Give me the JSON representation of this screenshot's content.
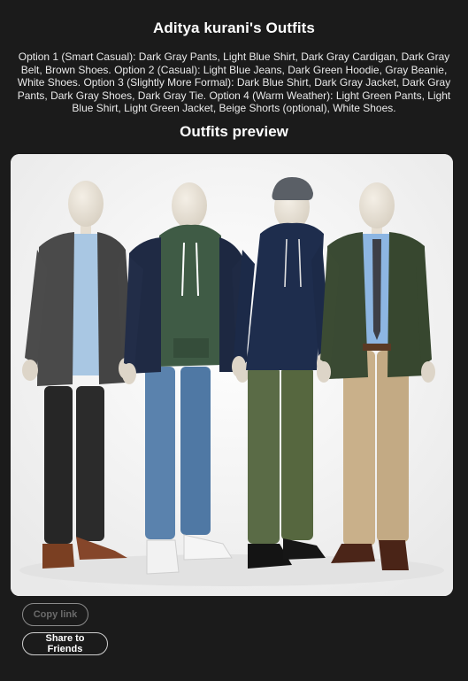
{
  "header": {
    "title": "Aditya kurani's Outfits"
  },
  "description": "Option 1 (Smart Casual): Dark Gray Pants, Light Blue Shirt, Dark Gray Cardigan, Dark Gray Belt, Brown Shoes. Option 2 (Casual): Light Blue Jeans, Dark Green Hoodie, Gray Beanie, White Shoes. Option 3 (Slightly More Formal): Dark Blue Shirt, Dark Gray Jacket, Dark Gray Pants, Dark Gray Shoes, Dark Gray Tie. Option 4 (Warm Weather): Light Green Pants, Light Blue Shirt, Light Green Jacket, Beige Shorts (optional), White Shoes.",
  "preview": {
    "title": "Outfits preview"
  },
  "actions": {
    "copy_label": "Copy link",
    "share_label": "Share to Friends"
  },
  "colors": {
    "background": "#1b1b1b",
    "text": "#ffffff",
    "disabled_text": "#6a6a6a"
  }
}
